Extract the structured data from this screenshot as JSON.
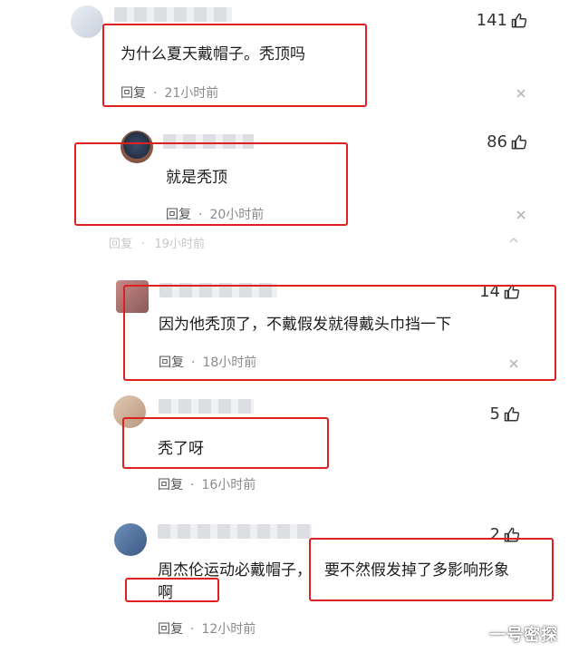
{
  "comments": [
    {
      "text": "为什么夏天戴帽子。秃顶吗",
      "reply_label": "回复",
      "time": "21小时前",
      "likes": "141"
    },
    {
      "text": "就是秃顶",
      "reply_label": "回复",
      "time": "20小时前",
      "likes": "86"
    },
    {
      "text": "因为他秃顶了，不戴假发就得戴头巾挡一下",
      "reply_label": "回复",
      "time": "18小时前",
      "likes": "14"
    },
    {
      "text": "秃了呀",
      "reply_label": "回复",
      "time": "16小时前",
      "likes": "5"
    },
    {
      "text_line1_left": "周杰伦运动必戴帽子，",
      "text_line1_right": "要不然假发掉了多影响形象",
      "text_line2": "啊",
      "reply_label": "回复",
      "time": "12小时前",
      "likes": "2"
    }
  ],
  "ghost_row": {
    "reply_label": "回复",
    "time": "19小时前"
  },
  "highlight_color": "#e02020",
  "icons": {
    "like": "thumbs-up-icon",
    "close": "close-icon",
    "collapse": "chevron-up-icon"
  },
  "watermark": "一号密探"
}
